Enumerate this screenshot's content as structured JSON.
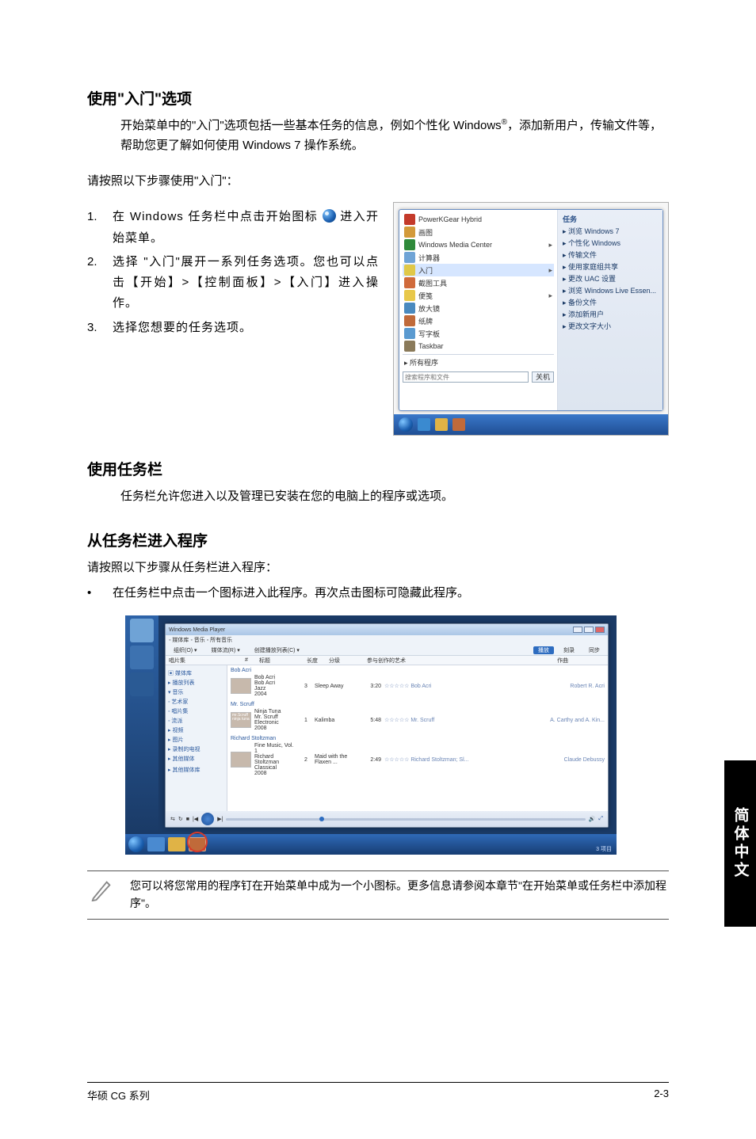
{
  "sections": {
    "s1_title": "使用\"入门\"选项",
    "s1_p1a": "开始菜单中的\"入门\"选项包括一些基本任务的信息，例如个性化 Windows",
    "s1_p1b": "，添加新用户，传输文件等，帮助您更了解如何使用 Windows 7 操作系统。",
    "s1_p2": "请按照以下步骤使用\"入门\"：",
    "s1_steps": [
      {
        "n": "1.",
        "a": "在 Windows 任务栏中点击开始图标 ",
        "b": " 进入开始菜单。"
      },
      {
        "n": "2.",
        "a": "选择 \"入门\"展开一系列任务选项。您也可以点击【开始】>【控制面板】>【入门】进入操作。",
        "b": ""
      },
      {
        "n": "3.",
        "a": "选择您想要的任务选项。",
        "b": ""
      }
    ],
    "s2_title": "使用任务栏",
    "s2_p1": "任务栏允许您进入以及管理已安装在您的电脑上的程序或选项。",
    "s3_title": "从任务栏进入程序",
    "s3_p1": "请按照以下步骤从任务栏进入程序：",
    "s3_bullet": "在任务栏中点击一个图标进入此程序。再次点击图标可隐藏此程序。"
  },
  "startmenu": {
    "left": [
      {
        "label": "PowerKGear Hybrid",
        "color": "#c43a2a",
        "arrow": false
      },
      {
        "label": "画图",
        "color": "#d39a3a",
        "arrow": false
      },
      {
        "label": "Windows Media Center",
        "color": "#2f8a3a",
        "arrow": true
      },
      {
        "label": "计算器",
        "color": "#6fa4d6",
        "arrow": false
      },
      {
        "label": "入门",
        "color": "#e0c848",
        "arrow": true,
        "hi": true
      },
      {
        "label": "截图工具",
        "color": "#d06a3a",
        "arrow": false
      },
      {
        "label": "便笺",
        "color": "#e8c84a",
        "arrow": true
      },
      {
        "label": "放大镜",
        "color": "#4a8abf",
        "arrow": false
      },
      {
        "label": "纸牌",
        "color": "#c06a3a",
        "arrow": false
      },
      {
        "label": "写字板",
        "color": "#5a9ad0",
        "arrow": false
      },
      {
        "label": "Taskbar",
        "color": "#8a7a5a",
        "arrow": false
      }
    ],
    "left_all": "▸ 所有程序",
    "right_head": "任务",
    "right": [
      "浏览 Windows 7",
      "个性化 Windows",
      "传输文件",
      "使用家庭组共享",
      "更改 UAC 设置",
      "浏览 Windows Live Essen...",
      "备份文件",
      "添加新用户",
      "更改文字大小"
    ],
    "search_btn": "搜索…▸",
    "shutdown": "关机"
  },
  "appwin": {
    "title": "Windows Media Player",
    "crumb": "◦ 媒体库 ◦ 音乐 ◦ 所有音乐",
    "toolbar": {
      "left1": "组织(O) ▾",
      "left2": "媒体流(R) ▾",
      "left3": "创建播放列表(C) ▾",
      "play": "播放",
      "burn": "刻录",
      "sync": "同步"
    },
    "cols": [
      "唱片集",
      " ",
      "#",
      "标题",
      "长度",
      "分级",
      "参与创作的艺术",
      "作曲"
    ],
    "side": [
      "▣ 媒体库",
      "▸ 播放列表",
      "▾ 音乐",
      "  ◦ 艺术家",
      "  ◦ 唱片集",
      "  ◦ 流派",
      "▸ 视频",
      "▸ 图片",
      "▸ 录制的电视",
      "▸ 其他媒体",
      " ",
      "▸ 其他媒体库"
    ],
    "groups": [
      {
        "head": "Bob Acri",
        "meta": [
          "Bob Acri",
          "Bob Acri",
          "Jazz",
          "2004"
        ],
        "rows": [
          {
            "n": "3",
            "title": "Sleep Away",
            "len": "3:20",
            "artist": "Bob Acri",
            "comp": "Robert R. Acri"
          }
        ]
      },
      {
        "head": "Mr. Scruff",
        "meta": [
          "Ninja Tuna",
          "Mr. Scruff",
          "Electronic",
          "2008"
        ],
        "thumb_text": "mr.Scruff ninja tuna",
        "rows": [
          {
            "n": "1",
            "title": "Kalimba",
            "len": "5:48",
            "artist": "Mr. Scruff",
            "comp": "A. Carthy and A. Kin..."
          }
        ]
      },
      {
        "head": "Richard Stoltzman",
        "meta": [
          "Fine Music, Vol. 1",
          "Richard Stoltzman",
          "Classical",
          "2008"
        ],
        "rows": [
          {
            "n": "2",
            "title": "Maid with the Flaxen ...",
            "len": "2:49",
            "artist": "Richard Stoltzman; Sl...",
            "comp": "Claude Debussy"
          }
        ]
      }
    ],
    "bottom_count": "3 项目"
  },
  "note": "您可以将您常用的程序钉在开始菜单中成为一个小图标。更多信息请参阅本章节\"在开始菜单或任务栏中添加程序\"。",
  "sidetab": "简体中文",
  "footer": {
    "left": "华硕 CG 系列",
    "right": "2-3"
  },
  "sup": "®"
}
